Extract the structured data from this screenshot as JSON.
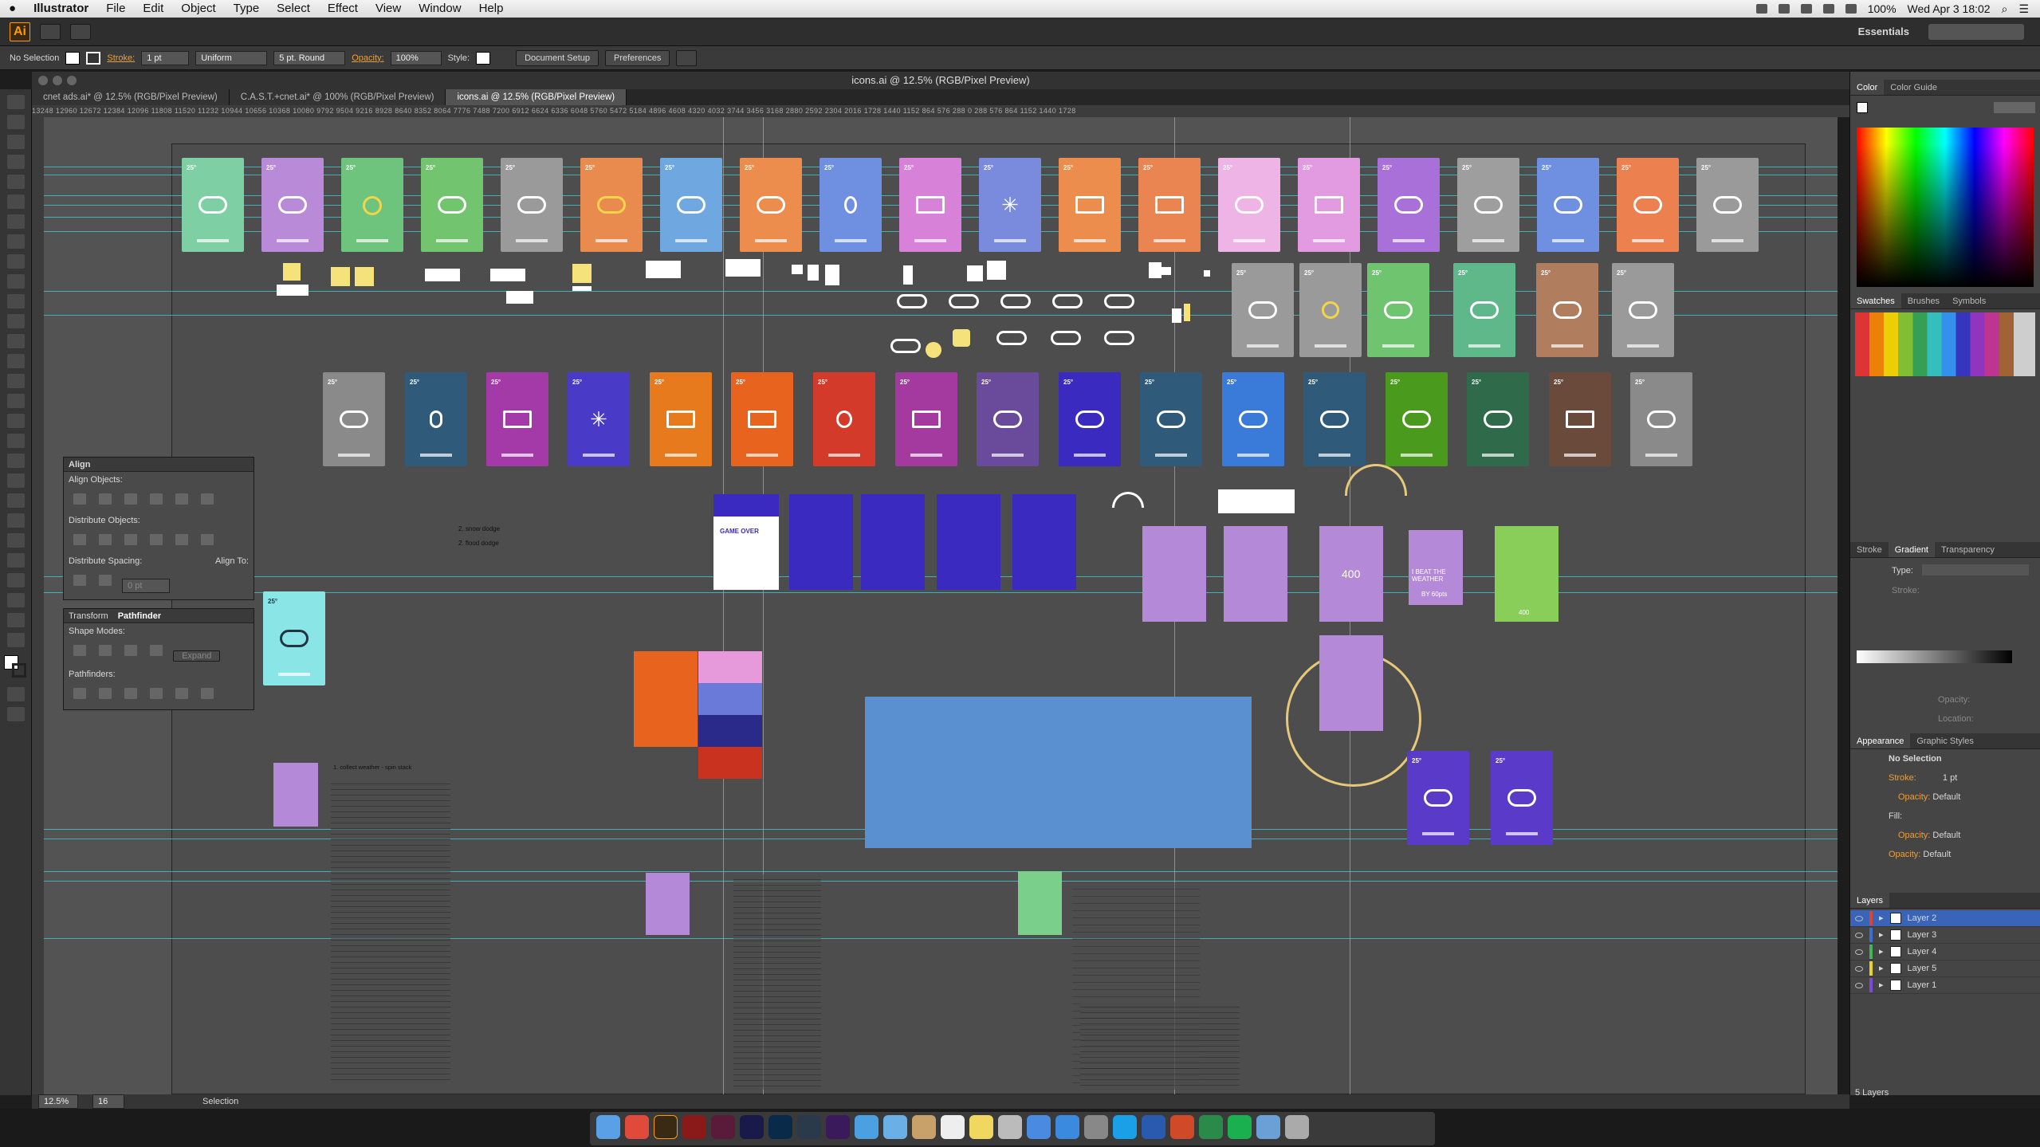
{
  "menubar": {
    "app": "Illustrator",
    "items": [
      "File",
      "Edit",
      "Object",
      "Type",
      "Select",
      "Effect",
      "View",
      "Window",
      "Help"
    ],
    "battery": "100%",
    "datetime": "Wed Apr 3  18:02"
  },
  "appbar": {
    "logo": "Ai",
    "workspace": "Essentials"
  },
  "control": {
    "selection": "No Selection",
    "stroke_label": "Stroke:",
    "stroke_value": "1 pt",
    "profile": "Uniform",
    "brush": "5 pt. Round",
    "opacity_label": "Opacity:",
    "opacity_value": "100%",
    "style_label": "Style:",
    "doc_setup": "Document Setup",
    "prefs": "Preferences"
  },
  "document": {
    "title": "icons.ai @ 12.5% (RGB/Pixel Preview)",
    "tabs": [
      "cnet ads.ai* @ 12.5% (RGB/Pixel Preview)",
      "C.A.S.T.+cnet.ai* @ 100% (RGB/Pixel Preview)",
      "icons.ai @ 12.5% (RGB/Pixel Preview)"
    ]
  },
  "ruler_text": "13248 12960 12672 12384 12096 11808 11520 11232 10944 10656 10368 10080 9792 9504 9216 8928 8640 8352 8064 7776 7488 7200 6912 6624 6336 6048 5760 5472 5184 4896 4608 4320 4032 3744 3456 3168 2880 2592 2304 2016 1728 1440 1152 864 576 288 0 288 576 864 1152 1440 1728",
  "artwork": {
    "card_temp": "25°",
    "labels": [
      "2. snow dodge",
      "2. flood dodge",
      "1. collect weather - spin stack",
      "GAME OVER",
      "400",
      "I BEAT THE WEATHER",
      "BY 60pts",
      "400"
    ]
  },
  "align_panel": {
    "title": "Align",
    "align_objects": "Align Objects:",
    "distribute_objects": "Distribute Objects:",
    "distribute_spacing": "Distribute Spacing:",
    "align_to": "Align To:",
    "spacing_value": "0 pt"
  },
  "pathfinder_panel": {
    "tab1": "Transform",
    "tab2": "Pathfinder",
    "shape_modes": "Shape Modes:",
    "pathfinders": "Pathfinders:",
    "expand": "Expand"
  },
  "dock": {
    "color_tabs": [
      "Color",
      "Color Guide"
    ],
    "swatch_tabs": [
      "Swatches",
      "Brushes",
      "Symbols"
    ],
    "stroke_tabs": [
      "Stroke",
      "Gradient",
      "Transparency"
    ],
    "gradient": {
      "type": "Type:",
      "stroke": "Stroke:",
      "opacity": "Opacity:",
      "location": "Location:"
    },
    "appearance_tabs": [
      "Appearance",
      "Graphic Styles"
    ],
    "appearance": {
      "selection": "No Selection",
      "stroke": "Stroke:",
      "stroke_val": "1 pt",
      "opacity1": "Opacity:",
      "opacity1_val": "Default",
      "fill": "Fill:",
      "opacity2": "Opacity:",
      "opacity2_val": "Default",
      "opacity3": "Opacity:",
      "opacity3_val": "Default"
    },
    "layers_title": "Layers",
    "layers": [
      "Layer 2",
      "Layer 3",
      "Layer 4",
      "Layer 5",
      "Layer 1"
    ],
    "layer_colors": [
      "#e0432a",
      "#3a6fd6",
      "#44b35a",
      "#e8d22a",
      "#7a4bd6"
    ],
    "layers_count": "5 Layers"
  },
  "status": {
    "zoom": "12.5%",
    "page": "16",
    "tool": "Selection"
  }
}
